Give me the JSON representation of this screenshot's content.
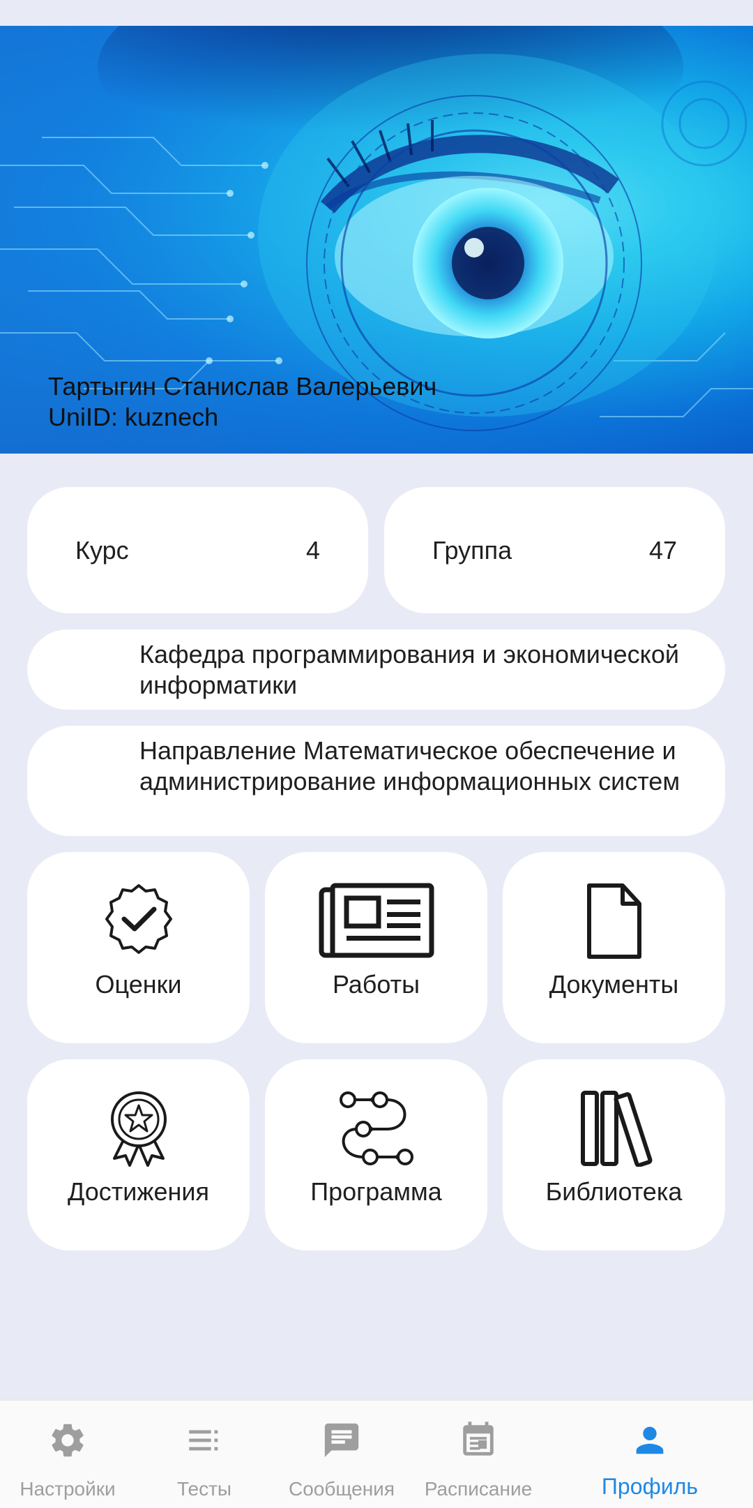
{
  "profile": {
    "full_name": "Тартыгин Станислав Валерьевич",
    "uniid": "UniID: kuznech"
  },
  "info": {
    "course_label": "Курс",
    "course_value": "4",
    "group_label": "Группа",
    "group_value": "47",
    "department": "Кафедра программирования и экономической информатики",
    "direction": "Направление Математическое обеспечение и администрирование информационных систем"
  },
  "tiles": [
    {
      "label": "Оценки",
      "icon": "grades-badge-icon"
    },
    {
      "label": "Работы",
      "icon": "newspaper-icon"
    },
    {
      "label": "Документы",
      "icon": "document-icon"
    },
    {
      "label": "Достижения",
      "icon": "award-icon"
    },
    {
      "label": "Программа",
      "icon": "flow-path-icon"
    },
    {
      "label": "Библиотека",
      "icon": "books-icon"
    }
  ],
  "nav": [
    {
      "label": "Настройки",
      "icon": "gear-icon",
      "active": false
    },
    {
      "label": "Тесты",
      "icon": "list-icon",
      "active": false
    },
    {
      "label": "Сообщения",
      "icon": "message-icon",
      "active": false
    },
    {
      "label": "Расписание",
      "icon": "calendar-icon",
      "active": false
    },
    {
      "label": "Профиль",
      "icon": "person-icon",
      "active": true
    }
  ],
  "colors": {
    "background": "#E8EAF6",
    "card": "#FFFFFF",
    "accent": "#1E88E5",
    "nav_inactive": "#9E9E9E"
  }
}
